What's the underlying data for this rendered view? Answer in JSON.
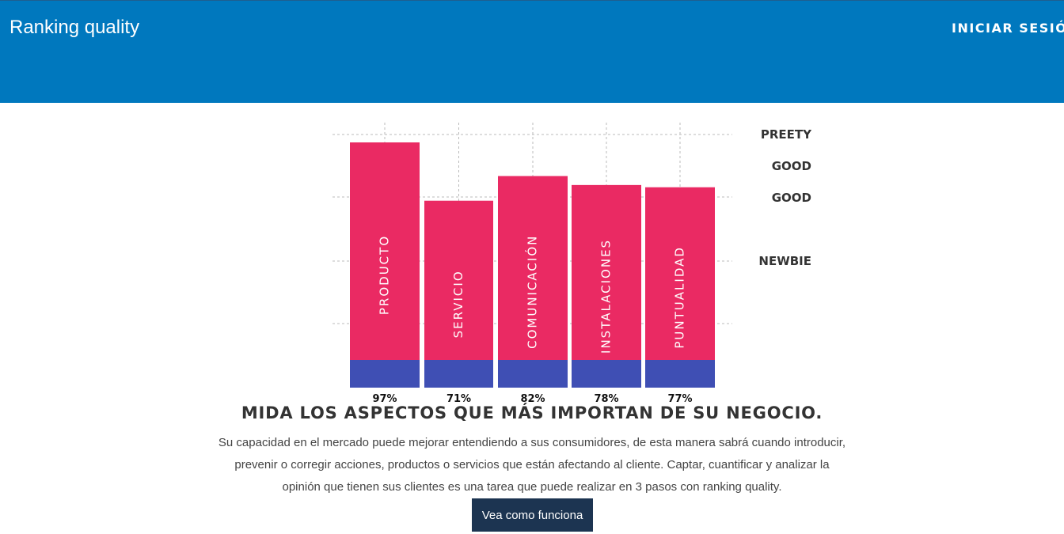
{
  "header": {
    "brand": "Ranking quality",
    "login_label": "INICIAR SESIÓN"
  },
  "colors": {
    "header_bg": "#0078be",
    "bar_primary": "#ea2a63",
    "bar_base": "#3f4fb4",
    "button_bg": "#1c3451"
  },
  "chart_data": {
    "type": "bar",
    "categories": [
      "PRODUCTO",
      "SERVICIO",
      "COMUNICACIÓN",
      "INSTALACIONES",
      "PUNTUALIDAD"
    ],
    "values": [
      97,
      71,
      82,
      78,
      77
    ],
    "value_labels": [
      "97%",
      "71%",
      "82%",
      "78%",
      "77%"
    ],
    "levels": [
      "PREETY",
      "GOOD",
      "GOOD",
      "NEWBIE"
    ],
    "grid": true
  },
  "main": {
    "headline": "MIDA LOS ASPECTOS QUE MÁS IMPORTAN DE SU NEGOCIO.",
    "description": "Su capacidad en el mercado puede mejorar entendiendo a sus consumidores, de esta manera sabrá cuando introducir, prevenir o corregir acciones, productos o servicios que están afectando al cliente. Captar, cuantificar y analizar la opinión que tienen sus clientes es una tarea que puede realizar en 3 pasos con ranking quality.",
    "cta_label": "Vea como funciona"
  }
}
